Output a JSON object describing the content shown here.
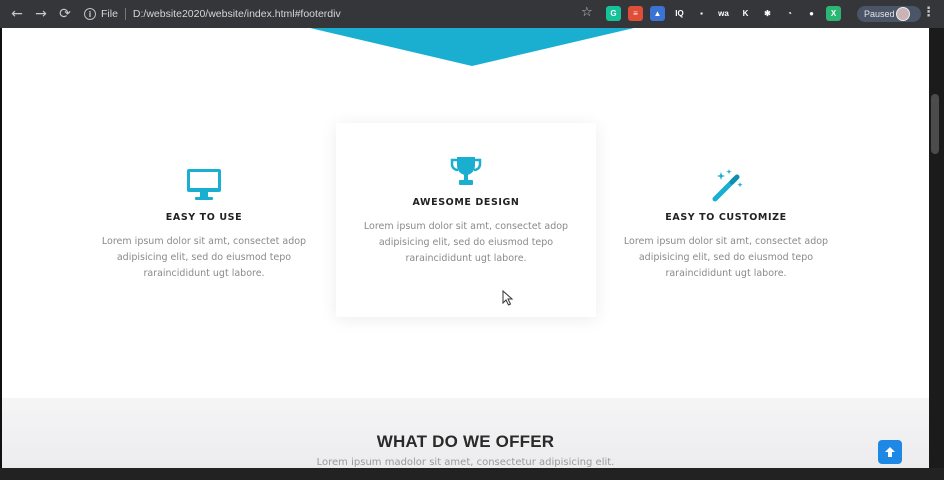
{
  "browser": {
    "protocol_label": "File",
    "url": "D:/website2020/website/index.html#footerdiv",
    "profile_status": "Paused",
    "extensions": [
      {
        "name": "grammarly-extension",
        "color": "#15c39a",
        "label": "G"
      },
      {
        "name": "notes-extension",
        "color": "#e04e39",
        "label": "≡"
      },
      {
        "name": "new-badge-extension",
        "color": "#3b73d4",
        "label": "▲"
      },
      {
        "name": "iq-extension",
        "color": "#35363a",
        "label": "IQ"
      },
      {
        "name": "tag-extension",
        "color": "#35363a",
        "label": "▪"
      },
      {
        "name": "wa-extension",
        "color": "#35363a",
        "label": "wa"
      },
      {
        "name": "k-extension",
        "color": "#35363a",
        "label": "K"
      },
      {
        "name": "puzzle-extension",
        "color": "#35363a",
        "label": "✱"
      },
      {
        "name": "timer-extension",
        "color": "#35363a",
        "label": "◔"
      },
      {
        "name": "dot-extension",
        "color": "#35363a",
        "label": "●"
      },
      {
        "name": "x-extension",
        "color": "#2bb673",
        "label": "X"
      }
    ]
  },
  "features": [
    {
      "icon": "monitor-icon",
      "title": "EASY TO USE",
      "text": "Lorem ipsum dolor sit amt, consectet adop adipisicing elit, sed do eiusmod tepo raraincididunt ugt labore."
    },
    {
      "icon": "trophy-icon",
      "title": "AWESOME DESIGN",
      "text": "Lorem ipsum dolor sit amt, consectet adop adipisicing elit, sed do eiusmod tepo raraincididunt ugt labore."
    },
    {
      "icon": "magic-wand-icon",
      "title": "EASY TO CUSTOMIZE",
      "text": "Lorem ipsum dolor sit amt, consectet adop adipisicing elit, sed do eiusmod tepo raraincididunt ugt labore."
    }
  ],
  "offer": {
    "title": "WHAT DO WE OFFER",
    "subtitle": "Lorem ipsum madolor sit amet, consectetur adipisicing elit."
  },
  "colors": {
    "accent": "#1aaed1",
    "back_to_top": "#1e88e5"
  }
}
